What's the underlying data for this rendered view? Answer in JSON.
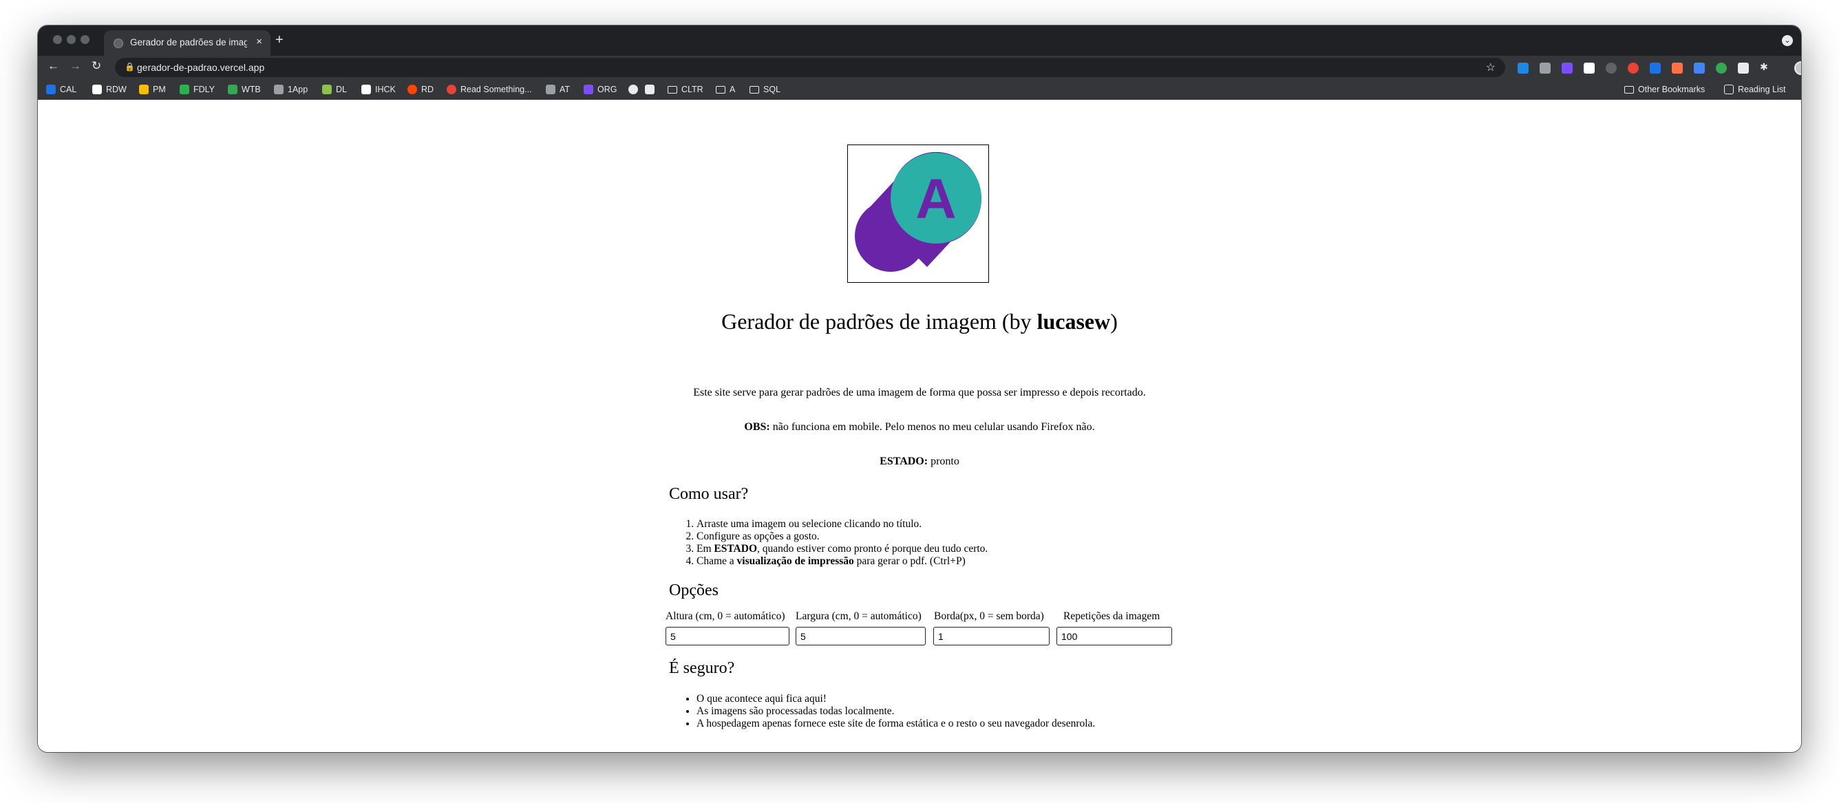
{
  "browser": {
    "tab_title": "Gerador de padrões de imagem",
    "tab_close": "×",
    "new_tab": "+",
    "url": "gerador-de-padrao.vercel.app",
    "bookmarks": [
      {
        "label": "CAL",
        "icon": "calendar-icon",
        "color": "#1a73e8"
      },
      {
        "label": "RDW",
        "icon": "r-icon",
        "color": "#ffffff"
      },
      {
        "label": "PM",
        "icon": "drive-icon",
        "color": "#fbbc04"
      },
      {
        "label": "FDLY",
        "icon": "feedly-icon",
        "color": "#2bb24c"
      },
      {
        "label": "WTB",
        "icon": "w-icon",
        "color": "#34a853"
      },
      {
        "label": "1App",
        "icon": "grid-icon",
        "color": "#9aa0a6"
      },
      {
        "label": "DL",
        "icon": "dl-icon",
        "color": "#8bc34a"
      },
      {
        "label": "IHCK",
        "icon": "ih-icon",
        "color": "#ffffff"
      },
      {
        "label": "RD",
        "icon": "reddit-icon",
        "color": "#ff4500"
      },
      {
        "label": "Read Something...",
        "icon": "stop-icon",
        "color": "#ea4335"
      },
      {
        "label": "AT",
        "icon": "asterisk-icon",
        "color": "#9aa0a6"
      },
      {
        "label": "ORG",
        "icon": "shield-icon",
        "color": "#7c4dff"
      },
      {
        "label": "",
        "icon": "globe-icon",
        "color": "#e8eaed"
      },
      {
        "label": "",
        "icon": "note-icon",
        "color": "#e8eaed"
      },
      {
        "label": "CLTR",
        "icon": "folder-icon",
        "color": "#e8eaed"
      },
      {
        "label": "A",
        "icon": "folder-icon",
        "color": "#e8eaed"
      },
      {
        "label": "SQL",
        "icon": "folder-icon",
        "color": "#e8eaed"
      }
    ],
    "other_bookmarks": "Other Bookmarks",
    "reading_list": "Reading List"
  },
  "page": {
    "logo_letter": "A",
    "logo_colors": {
      "circle": "#2bb0a8",
      "shadow": "#6a24a8"
    },
    "title_prefix": "Gerador de padrões de imagem (by ",
    "title_author": "lucasew",
    "title_suffix": ")",
    "description": "Este site serve para gerar padrões de uma imagem de forma que possa ser impresso e depois recortado.",
    "obs_label": "OBS:",
    "obs_text": " não funciona em mobile. Pelo menos no meu celular usando Firefox não.",
    "status_label": "ESTADO:",
    "status_value": " pronto",
    "how_to_heading": "Como usar?",
    "steps": {
      "s1": "Arraste uma imagem ou selecione clicando no título.",
      "s2": "Configure as opções a gosto.",
      "s3_a": "Em ",
      "s3_b": "ESTADO",
      "s3_c": ", quando estiver como pronto é porque deu tudo certo.",
      "s4_a": "Chame a ",
      "s4_b": "visualização de impressão",
      "s4_c": " para gerar o pdf. (Ctrl+P)"
    },
    "options_heading": "Opções",
    "options": [
      {
        "label": "Altura (cm, 0 = automático)",
        "value": "5"
      },
      {
        "label": "Largura (cm, 0 = automático)",
        "value": "5"
      },
      {
        "label": "Borda(px, 0 = sem borda)",
        "value": "1"
      },
      {
        "label": "Repetições da imagem",
        "value": "100"
      }
    ],
    "safe_heading": "É seguro?",
    "safe_items": [
      "O que acontece aqui fica aqui!",
      "As imagens são processadas todas localmente.",
      "A hospedagem apenas fornece este site de forma estática e o resto o seu navegador desenrola."
    ]
  }
}
